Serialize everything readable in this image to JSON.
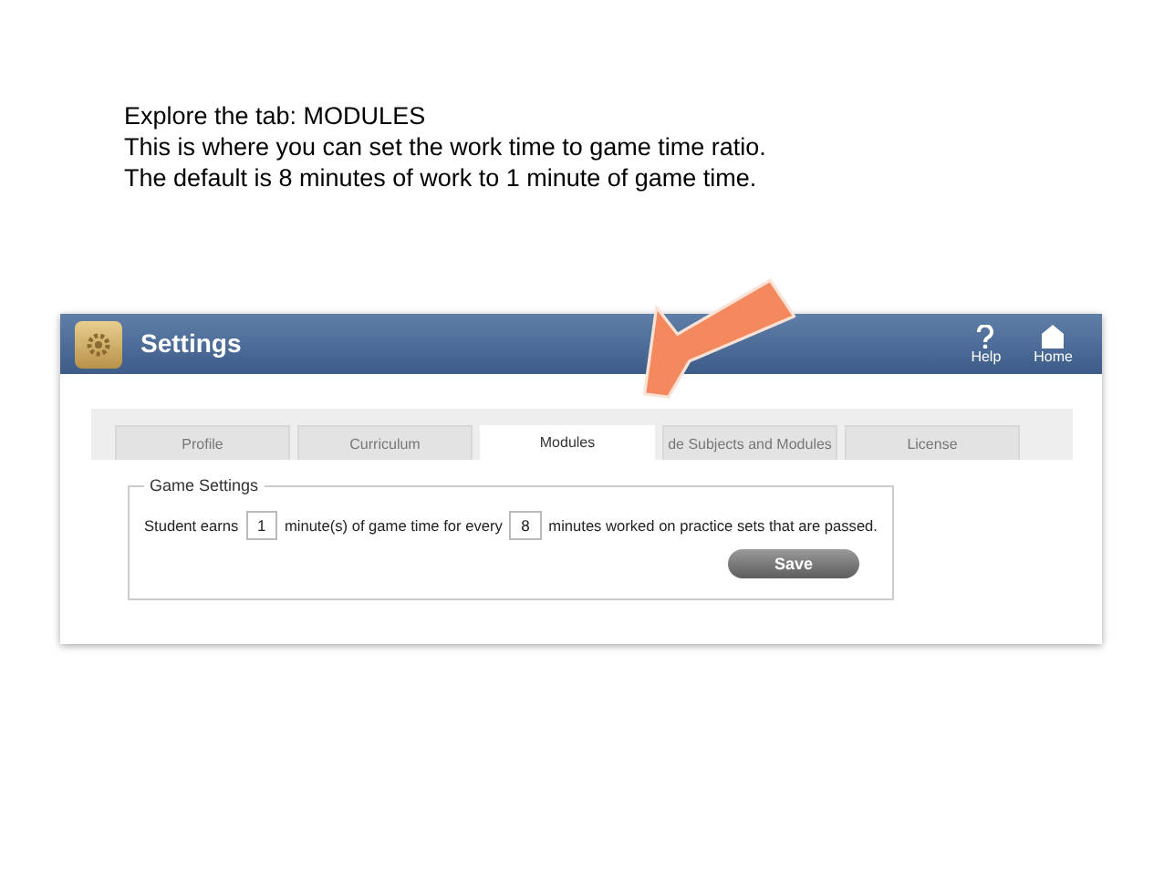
{
  "caption": [
    "Explore the tab: MODULES",
    "This is where you can set the work time to game time ratio.",
    "The default is 8 minutes of work to 1 minute of game time."
  ],
  "app": {
    "title": "Settings",
    "header_buttons": [
      {
        "kind": "help",
        "label": "Help"
      },
      {
        "kind": "home",
        "label": "Home"
      }
    ],
    "tabs": [
      {
        "label": "Profile",
        "selected": false
      },
      {
        "label": "Curriculum",
        "selected": false
      },
      {
        "label": "Modules",
        "selected": true
      },
      {
        "label": "de Subjects and Modules",
        "selected": false
      },
      {
        "label": "License",
        "selected": false
      }
    ],
    "group": {
      "title": "Game Settings",
      "parts": [
        {
          "kind": "text",
          "text": "Student earns"
        },
        {
          "kind": "field",
          "value": "1"
        },
        {
          "kind": "text",
          "text": "minute(s) of game time for every"
        },
        {
          "kind": "field",
          "value": "8"
        },
        {
          "kind": "text",
          "text": "minutes worked on practice sets that are passed."
        }
      ],
      "button": "Save"
    }
  }
}
